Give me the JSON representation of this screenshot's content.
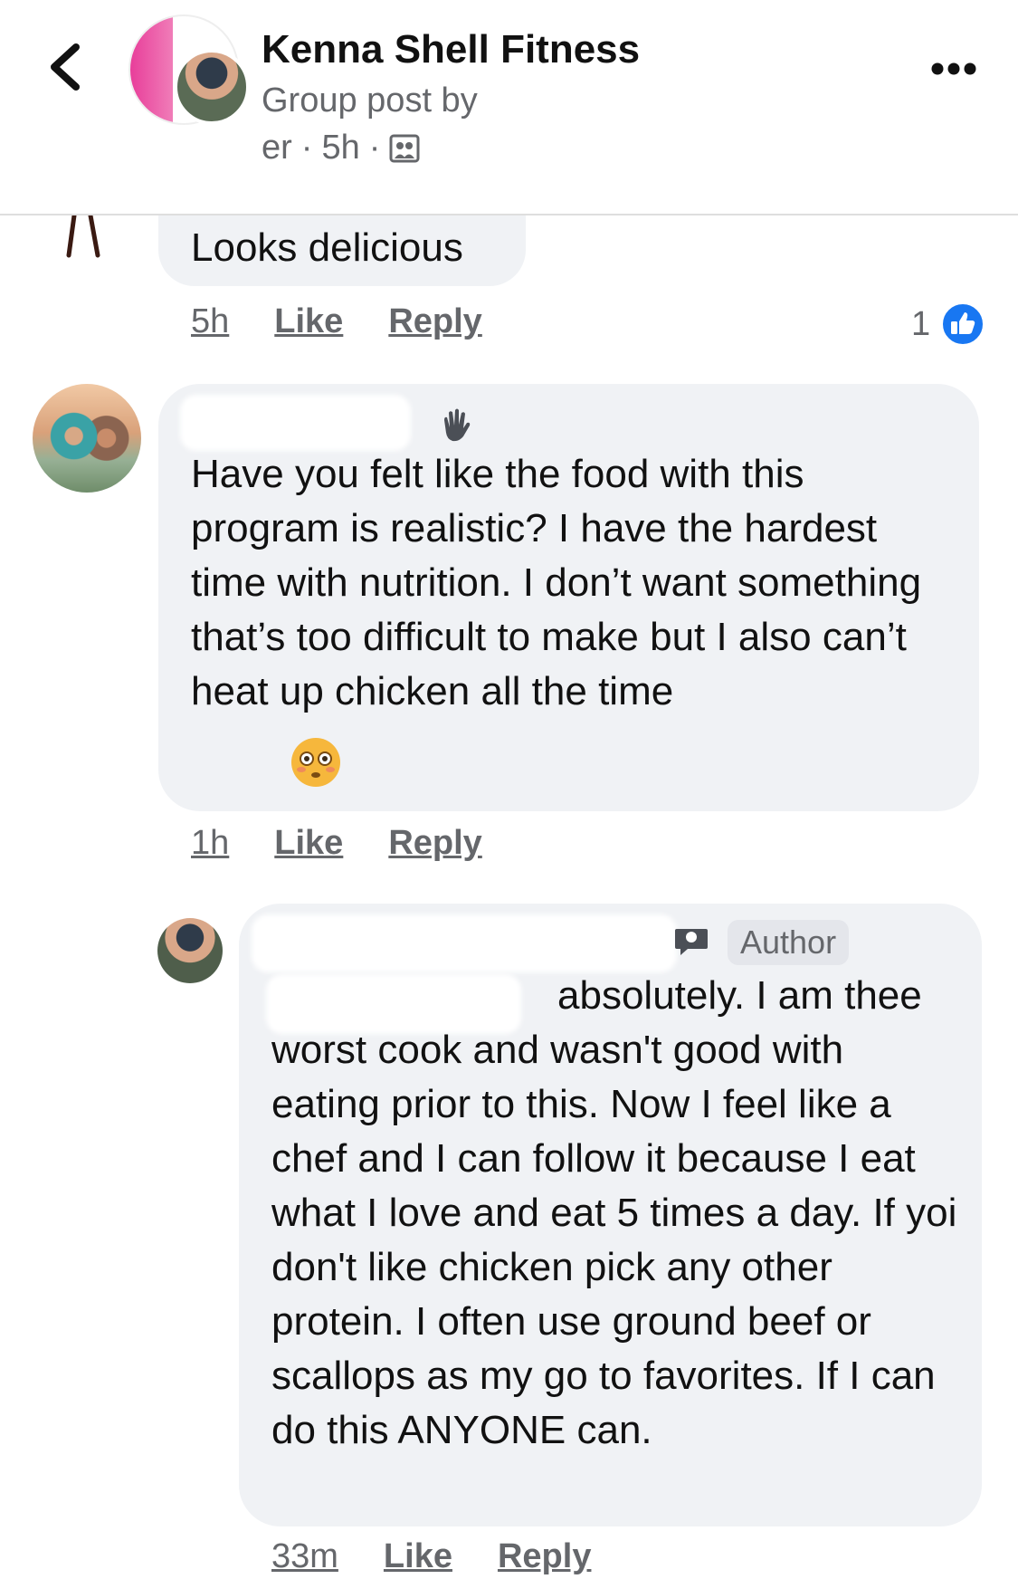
{
  "header": {
    "group_name": "Kenna Shell Fitness",
    "subtitle": "Group post by",
    "meta_prefix": "er",
    "meta_time": "5h",
    "meta_dot": "·"
  },
  "comments": [
    {
      "text": "Looks delicious",
      "time": "5h",
      "like_label": "Like",
      "reply_label": "Reply",
      "reaction_count": "1"
    },
    {
      "text": "Have you felt like the food with this program is realistic? I have the hardest time with nutrition. I don’t want something that’s too difficult to make but I also can’t heat up chicken all the time",
      "time": "1h",
      "like_label": "Like",
      "reply_label": "Reply"
    },
    {
      "badge": "Author",
      "text": "absolutely. I am thee worst cook and wasn't good with eating prior to this. Now I feel like a chef and I can follow it because I eat what I love and eat 5 times a day. If yoi don't like chicken pick any other protein. I often use ground beef or scallops as my go to favorites. If I can do this ANYONE can.",
      "time": "33m",
      "like_label": "Like",
      "reply_label": "Reply"
    }
  ],
  "colors": {
    "bubble": "#f0f2f5",
    "secondary_text": "#65676b",
    "like_blue": "#1877f2"
  }
}
